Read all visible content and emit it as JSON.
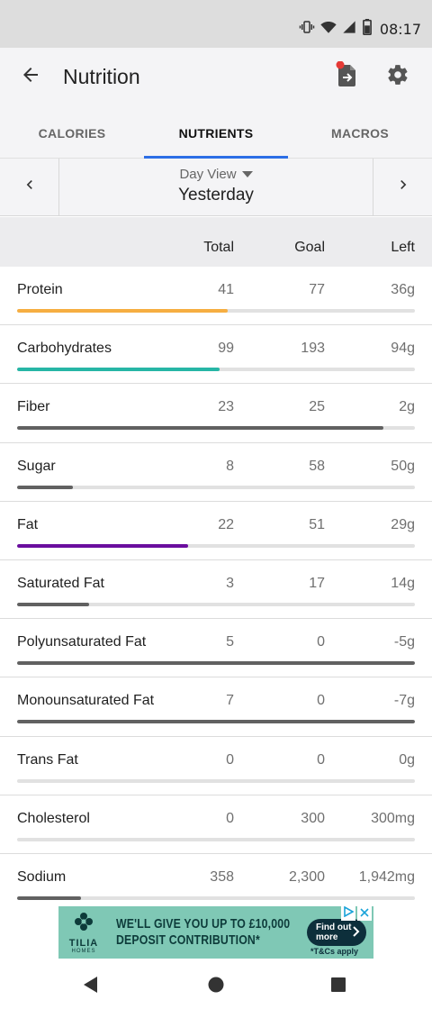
{
  "status_bar": {
    "time": "08:17"
  },
  "app_bar": {
    "title": "Nutrition"
  },
  "tabs": [
    {
      "label": "CALORIES",
      "active": false
    },
    {
      "label": "NUTRIENTS",
      "active": true
    },
    {
      "label": "MACROS",
      "active": false
    }
  ],
  "day_nav": {
    "view_label": "Day View",
    "day_label": "Yesterday"
  },
  "table": {
    "headers": {
      "total": "Total",
      "goal": "Goal",
      "left": "Left"
    },
    "rows": [
      {
        "name": "Protein",
        "total": "41",
        "goal": "77",
        "left": "36g",
        "progress": 0.53,
        "color": "#f6ae41"
      },
      {
        "name": "Carbohydrates",
        "total": "99",
        "goal": "193",
        "left": "94g",
        "progress": 0.51,
        "color": "#27b6a6"
      },
      {
        "name": "Fiber",
        "total": "23",
        "goal": "25",
        "left": "2g",
        "progress": 0.92,
        "color": "#616161"
      },
      {
        "name": "Sugar",
        "total": "8",
        "goal": "58",
        "left": "50g",
        "progress": 0.14,
        "color": "#616161"
      },
      {
        "name": "Fat",
        "total": "22",
        "goal": "51",
        "left": "29g",
        "progress": 0.43,
        "color": "#6a0d9e"
      },
      {
        "name": "Saturated Fat",
        "total": "3",
        "goal": "17",
        "left": "14g",
        "progress": 0.18,
        "color": "#616161"
      },
      {
        "name": "Polyunsaturated Fat",
        "total": "5",
        "goal": "0",
        "left": "-5g",
        "progress": 1.0,
        "color": "#616161"
      },
      {
        "name": "Monounsaturated Fat",
        "total": "7",
        "goal": "0",
        "left": "-7g",
        "progress": 1.0,
        "color": "#616161"
      },
      {
        "name": "Trans Fat",
        "total": "0",
        "goal": "0",
        "left": "0g",
        "progress": 0.0,
        "color": "#616161"
      },
      {
        "name": "Cholesterol",
        "total": "0",
        "goal": "300",
        "left": "300mg",
        "progress": 0.0,
        "color": "#616161"
      },
      {
        "name": "Sodium",
        "total": "358",
        "goal": "2,300",
        "left": "1,942mg",
        "progress": 0.16,
        "color": "#616161"
      }
    ]
  },
  "ad": {
    "brand": "TILIA",
    "brand_sub": "HOMES",
    "line1": "WE'LL GIVE YOU UP TO £10,000",
    "line2": "DEPOSIT CONTRIBUTION*",
    "cta": "Find out more",
    "terms": "*T&Cs apply"
  },
  "icons": {
    "back": "arrow-left-icon",
    "share": "export-document-icon",
    "settings": "gear-icon",
    "prev": "chevron-left-icon",
    "next": "chevron-right-icon",
    "dropdown": "caret-down-icon"
  },
  "colors": {
    "accent": "#2c6ee6",
    "notification_dot": "#e53935"
  }
}
